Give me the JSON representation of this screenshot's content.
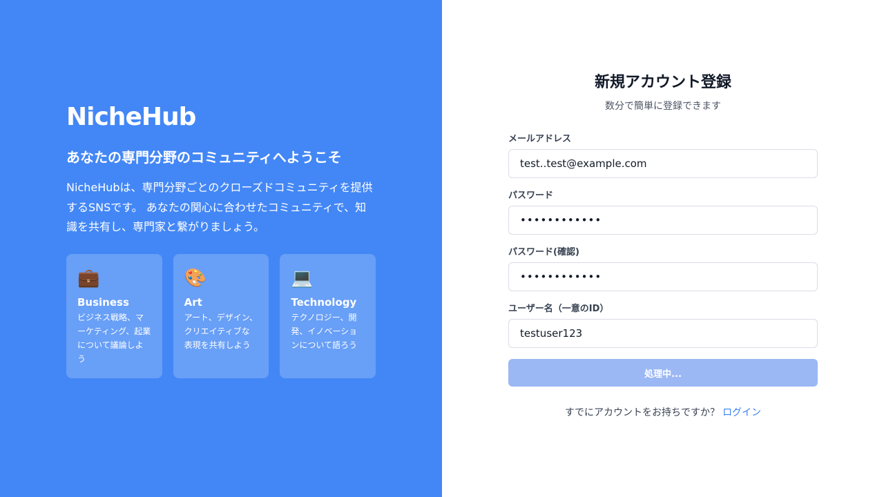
{
  "hero": {
    "brand": "NicheHub",
    "tagline": "あなたの専門分野のコミュニティへようこそ",
    "intro": "NicheHubは、専門分野ごとのクローズドコミュニティを提供するSNSです。 あなたの関心に合わせたコミュニティで、知識を共有し、専門家と繋がりましょう。",
    "cards": [
      {
        "icon": "briefcase-icon",
        "glyph": "💼",
        "title": "Business",
        "desc": "ビジネス戦略、マーケティング、起業について議論しよう"
      },
      {
        "icon": "palette-icon",
        "glyph": "🎨",
        "title": "Art",
        "desc": "アート、デザイン、クリエイティブな表現を共有しよう"
      },
      {
        "icon": "laptop-icon",
        "glyph": "💻",
        "title": "Technology",
        "desc": "テクノロジー、開発、イノベーションについて語ろう"
      }
    ]
  },
  "form": {
    "title": "新規アカウント登録",
    "subtitle": "数分で簡単に登録できます",
    "email": {
      "label": "メールアドレス",
      "value": "test..test@example.com"
    },
    "password": {
      "label": "パスワード",
      "value": "••••••••••••"
    },
    "password_confirm": {
      "label": "パスワード(確認)",
      "value": "••••••••••••"
    },
    "username": {
      "label": "ユーザー名（一意のID）",
      "value": "testuser123"
    },
    "submit_label": "処理中...",
    "footer_text": "すでにアカウントをお持ちですか？",
    "login_link": "ログイン"
  },
  "colors": {
    "hero_bg": "#4387f6",
    "submit_disabled": "#9bb8f4",
    "link": "#3b82f6"
  }
}
